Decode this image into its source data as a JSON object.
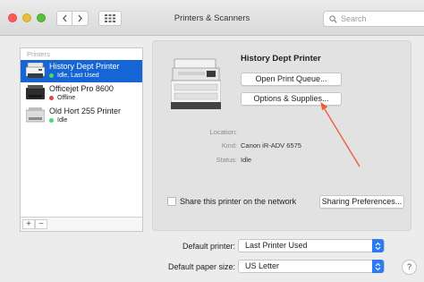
{
  "window": {
    "title": "Printers & Scanners"
  },
  "search": {
    "placeholder": "Search"
  },
  "sidebar": {
    "header": "Printers",
    "printers": [
      {
        "name": "History Dept Printer",
        "status": "Idle, Last Used",
        "status_color": "#4cd964",
        "selected": true
      },
      {
        "name": "Officejet Pro 8600",
        "status": "Offline",
        "status_color": "#e2453c",
        "selected": false
      },
      {
        "name": "Old Hort 255 Printer",
        "status": "Idle",
        "status_color": "#4cd964",
        "selected": false
      }
    ],
    "add_label": "+",
    "remove_label": "−"
  },
  "detail": {
    "printer_name": "History Dept Printer",
    "open_queue_label": "Open Print Queue...",
    "options_supplies_label": "Options & Supplies...",
    "location_label": "Location:",
    "location_value": "",
    "kind_label": "Kind:",
    "kind_value": "Canon iR-ADV 6575",
    "status_label": "Status:",
    "status_value": "Idle",
    "share_label": "Share this printer on the network",
    "share_checked": false,
    "sharing_prefs_label": "Sharing Preferences..."
  },
  "defaults": {
    "default_printer_label": "Default printer:",
    "default_printer_value": "Last Printer Used",
    "paper_size_label": "Default paper size:",
    "paper_size_value": "US Letter"
  },
  "help_label": "?",
  "colors": {
    "selection": "#1565d4",
    "accent": "#2c7bf2",
    "annotation_arrow": "#ef5a3a"
  }
}
